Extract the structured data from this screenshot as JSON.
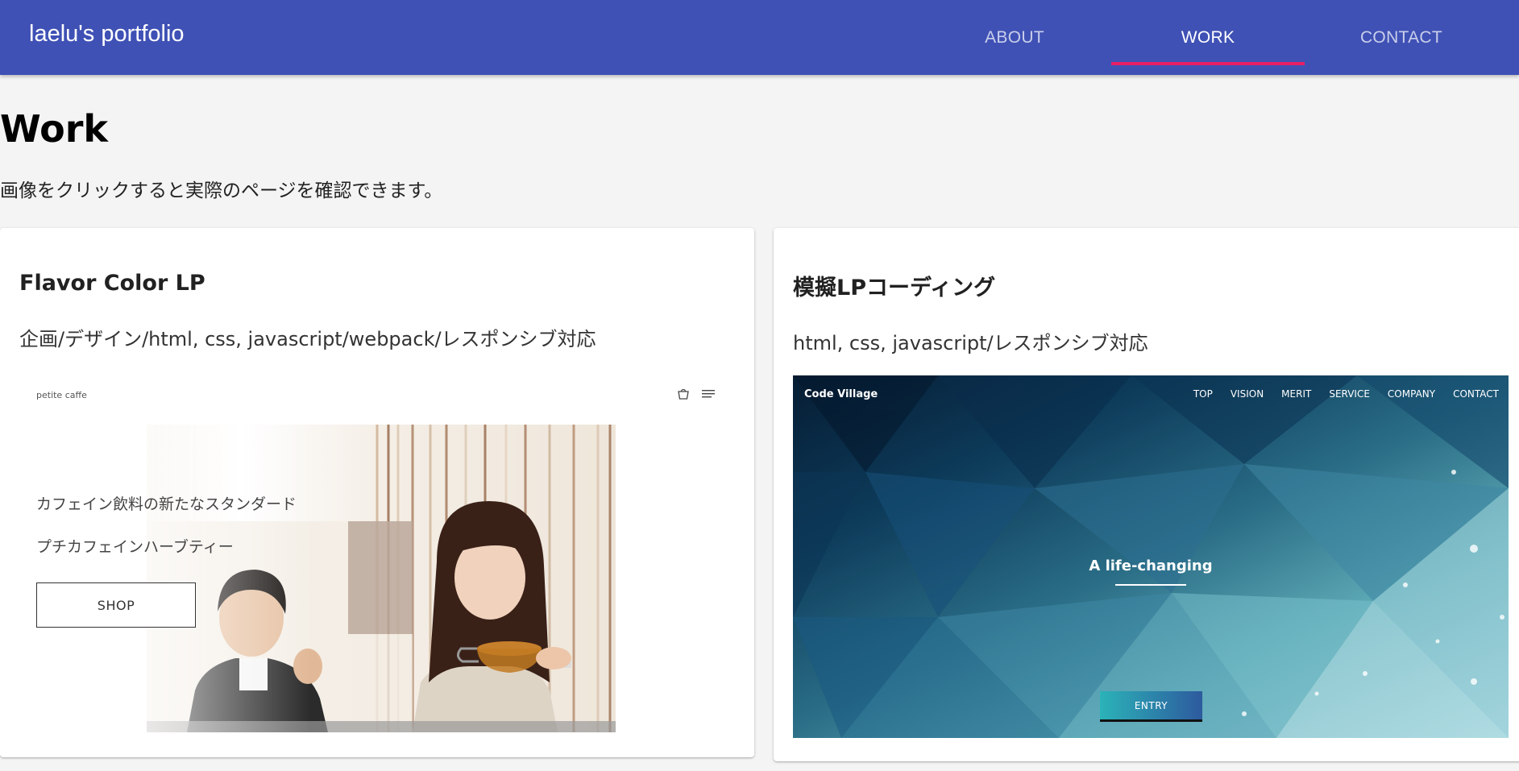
{
  "header": {
    "brand": "laelu's portfolio",
    "tabs": [
      {
        "label": "ABOUT"
      },
      {
        "label": "WORK"
      },
      {
        "label": "CONTACT"
      }
    ],
    "active_tab": "WORK"
  },
  "main": {
    "title": "Work",
    "lead": "画像をクリックすると実際のページを確認できます。"
  },
  "cards": [
    {
      "title": "Flavor Color LP",
      "description": "企画/デザイン/html, css, javascript/webpack/レスポンシブ対応",
      "thumbnail": {
        "logo": "petite caffe",
        "icons": [
          "shopping-bag-icon",
          "menu-icon"
        ],
        "copy_line_1": "カフェイン飲料の新たなスタンダード",
        "copy_line_2": "プチカフェインハーブティー",
        "button": "SHOP"
      }
    },
    {
      "title": "模擬LPコーディング",
      "description": "html, css, javascript/レスポンシブ対応",
      "thumbnail": {
        "logo": "Code Village",
        "nav": [
          "TOP",
          "VISION",
          "MERIT",
          "SERVICE",
          "COMPANY",
          "CONTACT"
        ],
        "headline": "A life-changing",
        "button": "ENTRY"
      }
    }
  ],
  "colors": {
    "appbar": "#3f51b5",
    "tab_indicator": "#e91e63",
    "page_background": "#f4f4f4"
  }
}
